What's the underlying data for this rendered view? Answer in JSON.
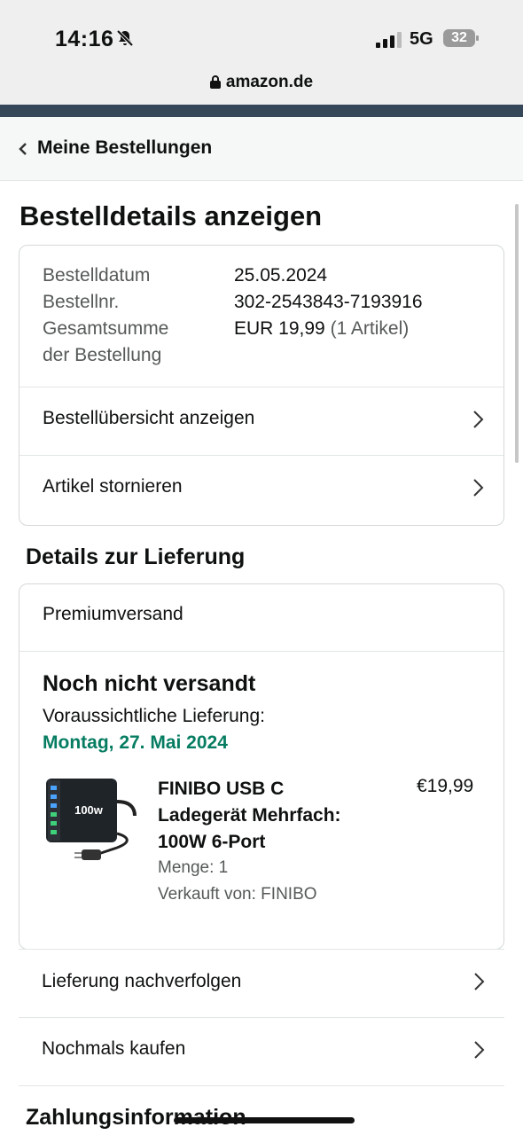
{
  "status_bar": {
    "time": "14:16",
    "network": "5G",
    "battery": "32"
  },
  "browser": {
    "url": "amazon.de"
  },
  "nav": {
    "back_label": "Meine Bestellungen"
  },
  "page": {
    "title": "Bestelldetails anzeigen"
  },
  "order_info": {
    "date_label": "Bestelldatum",
    "date_value": "25.05.2024",
    "number_label": "Bestellnr.",
    "number_value": "302-2543843-7193916",
    "total_label_line1": "Gesamtsumme",
    "total_label_line2": "der Bestellung",
    "total_value": "EUR 19,99",
    "total_items": "(1 Artikel)"
  },
  "order_actions": [
    {
      "label": "Bestellübersicht anzeigen"
    },
    {
      "label": "Artikel stornieren"
    }
  ],
  "delivery": {
    "section_title": "Details zur Lieferung",
    "shipping_type": "Premiumversand",
    "status": "Noch nicht versandt",
    "expected_label": "Voraussichtliche Lieferung:",
    "expected_date": "Montag, 27. Mai 2024",
    "expected_date_color": "#067d62",
    "item": {
      "title_line1": "FINIBO USB C",
      "title_line2": "Ladegerät Mehrfach:",
      "title_line3": "100W 6-Port",
      "price": "€19,99",
      "quantity": "Menge: 1",
      "seller": "Verkauft von: FINIBO",
      "image_badge": "100w",
      "image_icon": "usb-charger-icon"
    }
  },
  "delivery_actions": [
    {
      "label": "Lieferung nachverfolgen"
    },
    {
      "label": "Nochmals kaufen"
    }
  ],
  "payment": {
    "section_title": "Zahlungsinformation"
  },
  "colors": {
    "nav_band": "#36475a",
    "link_green": "#067d62"
  }
}
